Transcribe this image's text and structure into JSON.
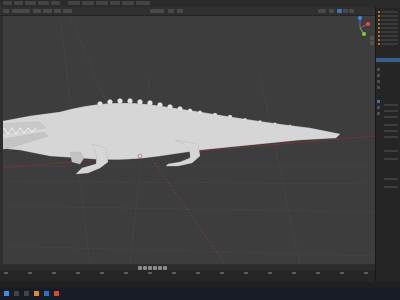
{
  "menu": {
    "items": [
      "",
      "",
      "",
      "",
      "",
      "",
      "",
      "",
      "",
      "",
      ""
    ]
  },
  "viewport": {
    "object": "crocodile-mesh",
    "background": "#3d3d3d",
    "grid_color": "#474747",
    "x_axis_color": "#9b3a3a",
    "y_axis_color": "#3d3d3d"
  },
  "timeline": {
    "current_frame": "",
    "start": "",
    "end": ""
  },
  "taskbar": {
    "time": "",
    "date": ""
  },
  "colors": {
    "selection": "#3a5f8f",
    "accent": "#e08a2d",
    "gizmo_x": "#e04b4b",
    "gizmo_y": "#84c13a",
    "gizmo_z": "#4a7fe0"
  }
}
